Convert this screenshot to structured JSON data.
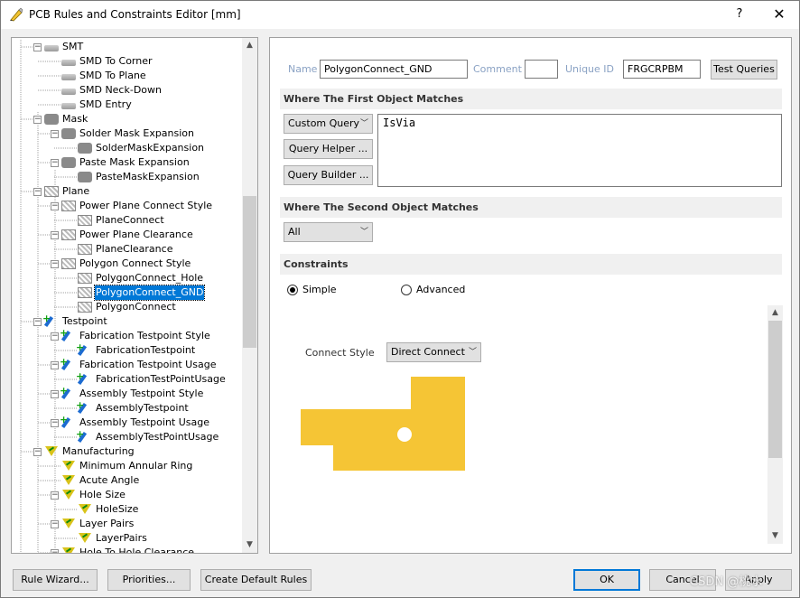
{
  "window": {
    "title": "PCB Rules and Constraints Editor [mm]",
    "help_label": "?",
    "close_label": "✕"
  },
  "tree": {
    "items": [
      {
        "label": "SMT",
        "level": 1,
        "icon": "smt-icon",
        "expander": "−"
      },
      {
        "label": "SMD To Corner",
        "level": 2,
        "icon": "smt-icon"
      },
      {
        "label": "SMD To Plane",
        "level": 2,
        "icon": "smt-icon"
      },
      {
        "label": "SMD Neck-Down",
        "level": 2,
        "icon": "smt-icon"
      },
      {
        "label": "SMD Entry",
        "level": 2,
        "icon": "smt-icon"
      },
      {
        "label": "Mask",
        "level": 1,
        "icon": "mask-icon",
        "expander": "−"
      },
      {
        "label": "Solder Mask Expansion",
        "level": 2,
        "icon": "mask-icon",
        "expander": "−"
      },
      {
        "label": "SolderMaskExpansion",
        "level": 3,
        "icon": "mask-icon"
      },
      {
        "label": "Paste Mask Expansion",
        "level": 2,
        "icon": "mask-icon",
        "expander": "−"
      },
      {
        "label": "PasteMaskExpansion",
        "level": 3,
        "icon": "mask-icon"
      },
      {
        "label": "Plane",
        "level": 1,
        "icon": "plane-icon",
        "expander": "−"
      },
      {
        "label": "Power Plane Connect Style",
        "level": 2,
        "icon": "plane-icon",
        "expander": "−"
      },
      {
        "label": "PlaneConnect",
        "level": 3,
        "icon": "plane-icon"
      },
      {
        "label": "Power Plane Clearance",
        "level": 2,
        "icon": "plane-icon",
        "expander": "−"
      },
      {
        "label": "PlaneClearance",
        "level": 3,
        "icon": "plane-icon"
      },
      {
        "label": "Polygon Connect Style",
        "level": 2,
        "icon": "plane-icon",
        "expander": "−"
      },
      {
        "label": "PolygonConnect_Hole",
        "level": 3,
        "icon": "plane-icon"
      },
      {
        "label": "PolygonConnect_GND",
        "level": 3,
        "icon": "plane-icon",
        "selected": true
      },
      {
        "label": "PolygonConnect",
        "level": 3,
        "icon": "plane-icon"
      },
      {
        "label": "Testpoint",
        "level": 1,
        "icon": "testpoint-icon",
        "expander": "−"
      },
      {
        "label": "Fabrication Testpoint Style",
        "level": 2,
        "icon": "testpoint-icon",
        "expander": "−"
      },
      {
        "label": "FabricationTestpoint",
        "level": 3,
        "icon": "testpoint-icon"
      },
      {
        "label": "Fabrication Testpoint Usage",
        "level": 2,
        "icon": "testpoint-icon",
        "expander": "−"
      },
      {
        "label": "FabricationTestPointUsage",
        "level": 3,
        "icon": "testpoint-icon"
      },
      {
        "label": "Assembly Testpoint Style",
        "level": 2,
        "icon": "testpoint-icon",
        "expander": "−"
      },
      {
        "label": "AssemblyTestpoint",
        "level": 3,
        "icon": "testpoint-icon"
      },
      {
        "label": "Assembly Testpoint Usage",
        "level": 2,
        "icon": "testpoint-icon",
        "expander": "−"
      },
      {
        "label": "AssemblyTestPointUsage",
        "level": 3,
        "icon": "testpoint-icon"
      },
      {
        "label": "Manufacturing",
        "level": 1,
        "icon": "manufacturing-icon",
        "expander": "−"
      },
      {
        "label": "Minimum Annular Ring",
        "level": 2,
        "icon": "manufacturing-icon"
      },
      {
        "label": "Acute Angle",
        "level": 2,
        "icon": "manufacturing-icon"
      },
      {
        "label": "Hole Size",
        "level": 2,
        "icon": "manufacturing-icon",
        "expander": "−"
      },
      {
        "label": "HoleSize",
        "level": 3,
        "icon": "manufacturing-icon"
      },
      {
        "label": "Layer Pairs",
        "level": 2,
        "icon": "manufacturing-icon",
        "expander": "−"
      },
      {
        "label": "LayerPairs",
        "level": 3,
        "icon": "manufacturing-icon"
      },
      {
        "label": "Hole To Hole Clearance",
        "level": 2,
        "icon": "manufacturing-icon",
        "expander": "−"
      }
    ]
  },
  "rule": {
    "name_label": "Name",
    "name_value": "PolygonConnect_GND",
    "comment_label": "Comment",
    "comment_value": "",
    "unique_id_label": "Unique ID",
    "unique_id_value": "FRGCRPBM",
    "test_queries_label": "Test Queries"
  },
  "first_match": {
    "header": "Where The First Object Matches",
    "mode": "Custom Query",
    "query_helper_label": "Query Helper ...",
    "query_builder_label": "Query Builder ...",
    "query_text": "IsVia"
  },
  "second_match": {
    "header": "Where The Second Object Matches",
    "mode": "All"
  },
  "constraints": {
    "header": "Constraints",
    "simple_label": "Simple",
    "advanced_label": "Advanced",
    "selected_mode": "Simple",
    "connect_style_label": "Connect Style",
    "connect_style_value": "Direct Connect",
    "preview_color": "#f5c535"
  },
  "footer": {
    "rule_wizard_label": "Rule Wizard...",
    "priorities_label": "Priorities...",
    "create_default_label": "Create Default Rules",
    "ok_label": "OK",
    "cancel_label": "Cancel",
    "apply_label": "Apply",
    "watermark": "CSDN @桃水"
  }
}
